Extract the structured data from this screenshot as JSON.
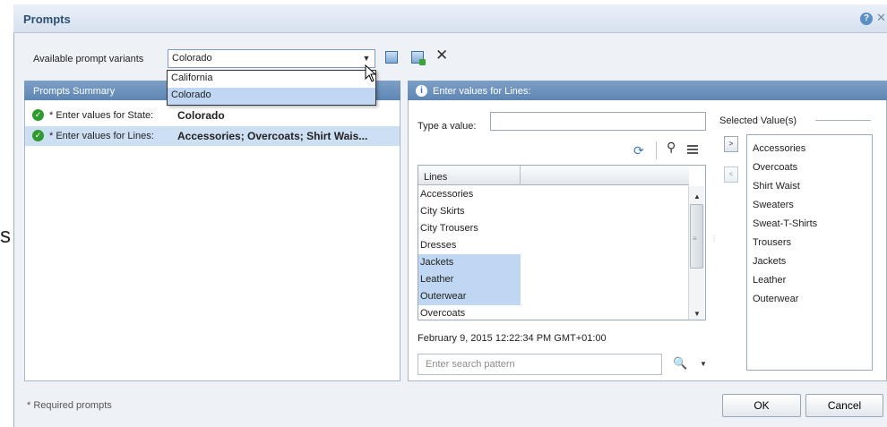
{
  "window": {
    "title": "Prompts",
    "help_icon": "help-icon",
    "help_glyph": "?",
    "close_glyph": "✕"
  },
  "edge_glyph": "s",
  "variants": {
    "label": "Available prompt variants",
    "selected": "Colorado",
    "options": [
      "California",
      "Colorado"
    ],
    "arrow_glyph": "▼",
    "icons": [
      "save-icon",
      "save-as-icon",
      "delete-icon"
    ],
    "delete_glyph": "✕"
  },
  "summary": {
    "header": "Prompts Summary",
    "prompts": [
      {
        "label": "* Enter values for State:",
        "value": "Colorado",
        "selected": false
      },
      {
        "label": "* Enter values for Lines:",
        "value": "Accessories; Overcoats; Shirt Wais...",
        "selected": true
      }
    ],
    "check_glyph": "✓"
  },
  "values_panel": {
    "header": "Enter values for Lines:",
    "info_glyph": "i",
    "type_label": "Type a value:",
    "type_value": "",
    "toolbar_icons": [
      "refresh-icon",
      "pin-icon",
      "list-icon"
    ],
    "refresh_glyph": "⟳",
    "pin_glyph": "⚲",
    "lines_column": "Lines",
    "lines": [
      {
        "label": "Accessories",
        "selected": false
      },
      {
        "label": "City Skirts",
        "selected": false
      },
      {
        "label": "City Trousers",
        "selected": false
      },
      {
        "label": "Dresses",
        "selected": false
      },
      {
        "label": "Jackets",
        "selected": true
      },
      {
        "label": "Leather",
        "selected": true
      },
      {
        "label": "Outerwear",
        "selected": true
      },
      {
        "label": "Overcoats",
        "selected": false
      }
    ],
    "scroll_up_glyph": "▲",
    "scroll_down_glyph": "▼",
    "scroll_grip_glyph": "≡",
    "timestamp": "February 9, 2015 12:22:34 PM GMT+01:00",
    "search_placeholder": "Enter search pattern",
    "binoculars_glyph": "🔍",
    "search_dropdown_glyph": "▼",
    "add_glyph": ">",
    "remove_glyph": "<",
    "splitter_glyph": "⋮"
  },
  "selected_values": {
    "label": "Selected Value(s)",
    "items": [
      "Accessories",
      "Overcoats",
      "Shirt Waist",
      "Sweaters",
      "Sweat-T-Shirts",
      "Trousers",
      "Jackets",
      "Leather",
      "Outerwear"
    ]
  },
  "footer": {
    "required_note": "* Required prompts",
    "ok": "OK",
    "cancel": "Cancel"
  }
}
